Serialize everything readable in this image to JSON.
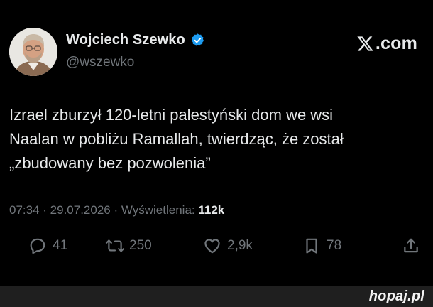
{
  "author": {
    "display_name": "Wojciech Szewko",
    "handle": "@wszewko"
  },
  "brand": {
    "domain": ".com"
  },
  "tweet": {
    "lines": [
      "Izrael zburzył 120-letni palestyński dom we wsi",
      "Naalan w pobliżu Ramallah, twierdząc, że został",
      "„zbudowany bez pozwolenia”"
    ]
  },
  "meta": {
    "time": "07:34",
    "separator_1": " · ",
    "date": "29.07.2026",
    "separator_2": " · ",
    "views_label": "Wyświetlenia: ",
    "views_count": "112k"
  },
  "actions": {
    "replies": "41",
    "reposts": "250",
    "likes": "2,9k",
    "bookmarks": "78"
  },
  "footer": {
    "site": "hopaj.pl"
  },
  "colors": {
    "background": "#000000",
    "text_primary": "#e7e9ea",
    "text_secondary": "#71767b",
    "verified_badge": "#1d9bf0",
    "footer_bar": "#1f1f1f"
  },
  "icons": {
    "verified": "verified-badge-icon",
    "brand": "x-logo-icon",
    "reply": "comment-icon",
    "repost": "repost-icon",
    "like": "heart-icon",
    "bookmark": "bookmark-icon",
    "share": "share-icon"
  }
}
